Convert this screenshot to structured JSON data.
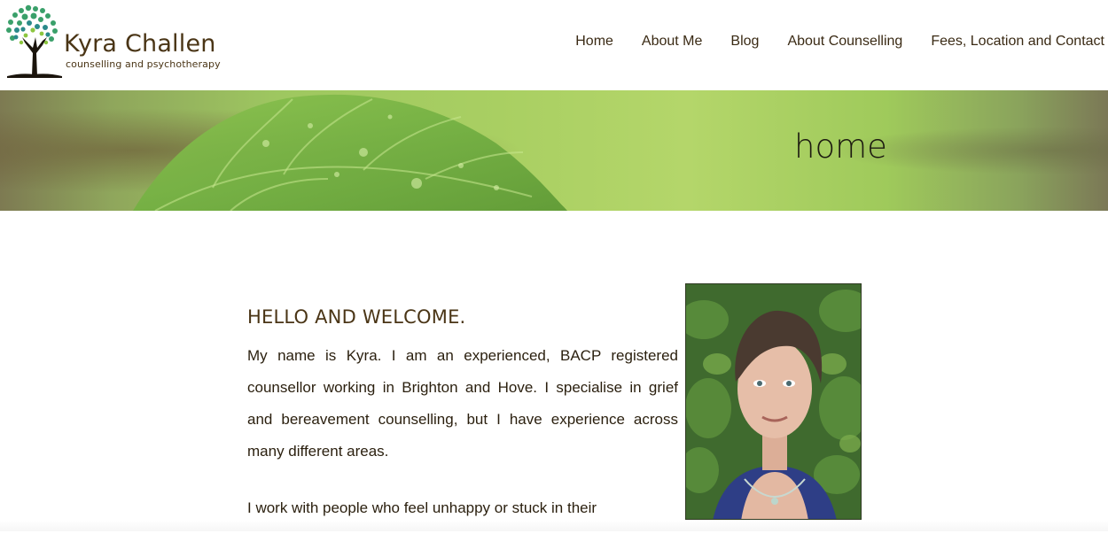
{
  "logo": {
    "name": "Kyra Challen",
    "tagline": "counselling and psychotherapy",
    "icon": "tree-icon"
  },
  "nav": {
    "items": [
      {
        "label": "Home"
      },
      {
        "label": "About Me"
      },
      {
        "label": "Blog"
      },
      {
        "label": "About Counselling"
      },
      {
        "label": "Fees, Location and Contact"
      }
    ]
  },
  "banner": {
    "title": "home",
    "image": "green-leaf-with-water-droplets"
  },
  "main": {
    "heading": "HELLO AND WELCOME.",
    "paragraph1": "My name is Kyra. I am an experienced, BACP registered counsellor working in Brighton and Hove. I specialise in grief and bereavement counselling, but I have experience across many different areas.",
    "paragraph2": "I work with people who feel unhappy or stuck in their",
    "photo": "portrait-photo"
  },
  "colors": {
    "text_brown": "#3a2a14",
    "banner_green": "#a9cf62",
    "tree_green": "#3aa06a",
    "tree_teal": "#2a8a8a"
  }
}
